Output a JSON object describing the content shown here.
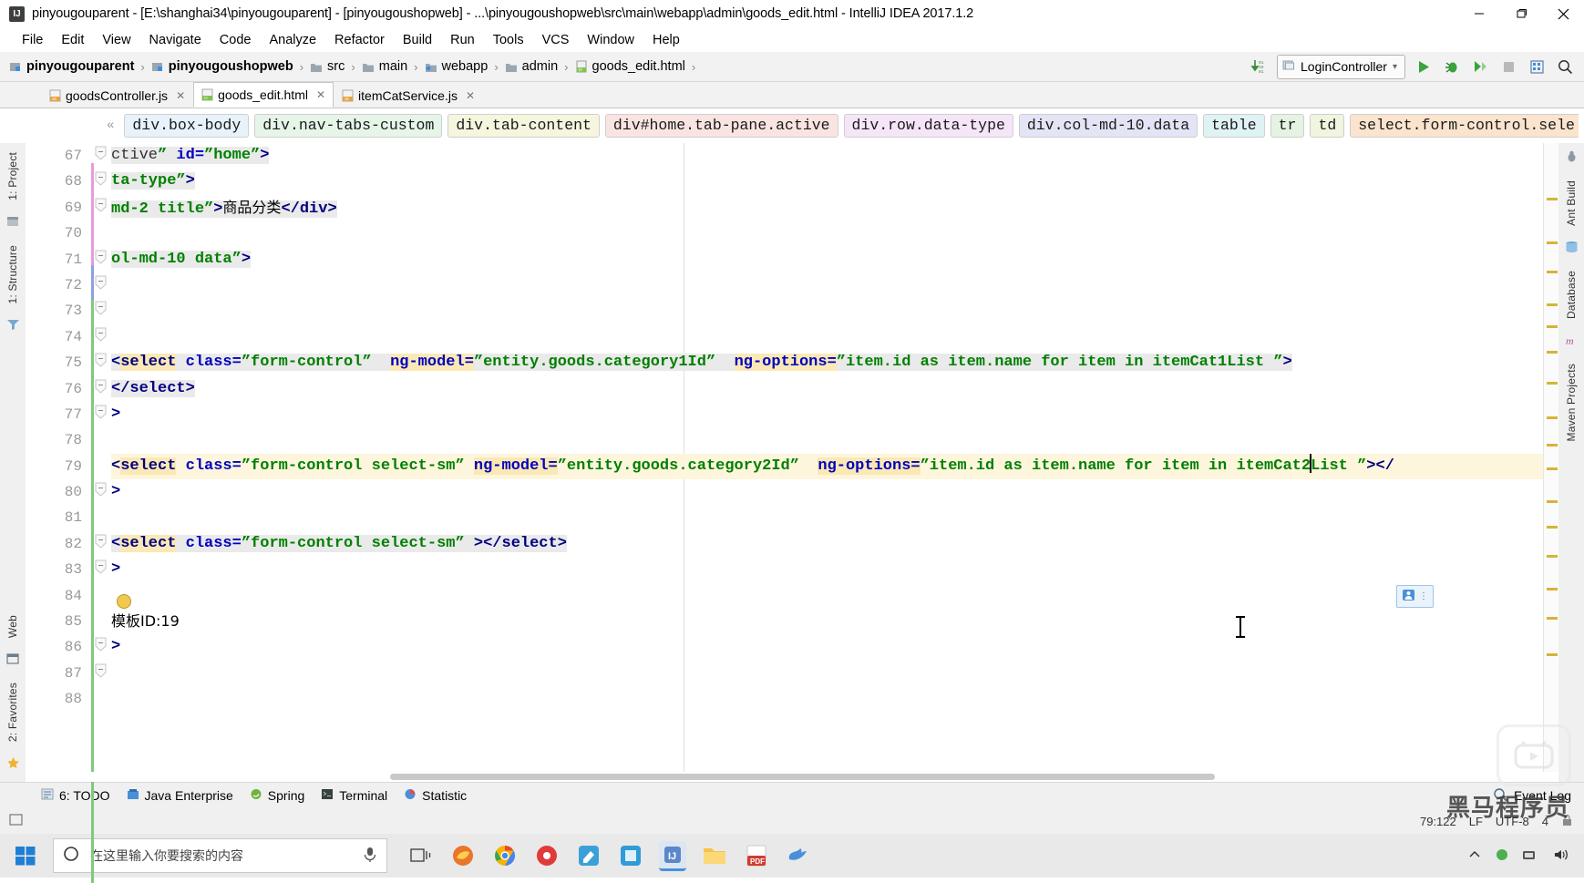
{
  "window": {
    "title": "pinyougouparent - [E:\\shanghai34\\pinyougouparent] - [pinyougoushopweb] - ...\\pinyougoushopweb\\src\\main\\webapp\\admin\\goods_edit.html - IntelliJ IDEA 2017.1.2",
    "app_icon": "intellij-idea-icon",
    "minimize": "─",
    "maximize": "❐",
    "close": "✕"
  },
  "menu": {
    "items": [
      "File",
      "Edit",
      "View",
      "Navigate",
      "Code",
      "Analyze",
      "Refactor",
      "Build",
      "Run",
      "Tools",
      "VCS",
      "Window",
      "Help"
    ]
  },
  "navbar": {
    "crumbs": [
      {
        "label": "pinyougouparent",
        "icon": "module-icon",
        "bold": true
      },
      {
        "label": "pinyougoushopweb",
        "icon": "module-icon",
        "bold": true
      },
      {
        "label": "src",
        "icon": "folder-icon",
        "bold": false
      },
      {
        "label": "main",
        "icon": "folder-icon",
        "bold": false
      },
      {
        "label": "webapp",
        "icon": "folder-web-icon",
        "bold": false
      },
      {
        "label": "admin",
        "icon": "folder-icon",
        "bold": false
      },
      {
        "label": "goods_edit.html",
        "icon": "html-file-icon",
        "bold": false
      }
    ],
    "separator": "›",
    "run_config": "LoginController",
    "run_config_dropdown": "▾",
    "buttons": [
      "update-running-application-icon",
      "run-icon",
      "debug-icon",
      "run-coverage-icon",
      "stop-icon",
      "toggle-layout-icon",
      "search-everywhere-icon"
    ]
  },
  "tabs": [
    {
      "label": "goodsController.js",
      "icon": "js-file-icon",
      "active": false,
      "close": "✕"
    },
    {
      "label": "goods_edit.html",
      "icon": "html-file-icon",
      "active": true,
      "close": "✕"
    },
    {
      "label": "itemCatService.js",
      "icon": "js-file-icon",
      "active": false,
      "close": "✕"
    }
  ],
  "breadcrumb_selectors": {
    "collapse_label": "«",
    "pills": [
      {
        "label": "div.box-body",
        "color": "#e7f2fb"
      },
      {
        "label": "div.nav-tabs-custom",
        "color": "#e5f5e8"
      },
      {
        "label": "div.tab-content",
        "color": "#f6f6df"
      },
      {
        "label": "div#home.tab-pane.active",
        "color": "#fae4e2"
      },
      {
        "label": "div.row.data-type",
        "color": "#f6e5f8"
      },
      {
        "label": "div.col-md-10.data",
        "color": "#e3e4f5"
      },
      {
        "label": "table",
        "color": "#dff2f4"
      },
      {
        "label": "tr",
        "color": "#e5f3e3"
      },
      {
        "label": "td",
        "color": "#eff5df"
      },
      {
        "label": "select.form-control.sele",
        "color": "#fae4cd"
      }
    ]
  },
  "editor": {
    "first_line": 67,
    "lines": [
      {
        "n": 67,
        "tokens": [
          {
            "t": "plain",
            "s": "ctive"
          },
          {
            "t": "val",
            "s": "” "
          },
          {
            "t": "attr",
            "s": "id="
          },
          {
            "t": "val",
            "s": "”home”"
          },
          {
            "t": "tag",
            "s": ">"
          }
        ],
        "soft": true
      },
      {
        "n": 68,
        "tokens": [
          {
            "t": "val",
            "s": "ta-type”"
          },
          {
            "t": "tag",
            "s": ">"
          }
        ],
        "soft": true
      },
      {
        "n": 69,
        "tokens": [
          {
            "t": "val",
            "s": "md-2 title”"
          },
          {
            "t": "tag",
            "s": ">"
          },
          {
            "t": "cjk",
            "s": "商品分类"
          },
          {
            "t": "tag",
            "s": "</div>"
          }
        ],
        "soft": true
      },
      {
        "n": 70,
        "tokens": [],
        "soft": false
      },
      {
        "n": 71,
        "tokens": [
          {
            "t": "val",
            "s": "ol-md-10 data”"
          },
          {
            "t": "tag",
            "s": ">"
          }
        ],
        "soft": true
      },
      {
        "n": 72,
        "tokens": [],
        "soft": false
      },
      {
        "n": 73,
        "tokens": [],
        "soft": false
      },
      {
        "n": 74,
        "tokens": [],
        "soft": false
      },
      {
        "n": 75,
        "tokens": [
          {
            "t": "tag",
            "s": "<"
          },
          {
            "t": "hltag",
            "s": "select"
          },
          {
            "t": "plain",
            "s": " "
          },
          {
            "t": "attr",
            "s": "class="
          },
          {
            "t": "val",
            "s": "”form-control”"
          },
          {
            "t": "plain",
            "s": "  "
          },
          {
            "t": "hlattr",
            "s": "ng-model="
          },
          {
            "t": "val",
            "s": "”entity.goods.category1Id”"
          },
          {
            "t": "plain",
            "s": "  "
          },
          {
            "t": "hlattr",
            "s": "ng-options="
          },
          {
            "t": "val",
            "s": "”item.id as item.name for item in itemCat1List ”"
          },
          {
            "t": "tag",
            "s": ">"
          }
        ],
        "soft": true
      },
      {
        "n": 76,
        "tokens": [
          {
            "t": "tag",
            "s": "</select>"
          }
        ],
        "soft": true
      },
      {
        "n": 77,
        "tokens": [
          {
            "t": "tag",
            "s": ">"
          }
        ],
        "soft": false
      },
      {
        "n": 78,
        "tokens": [],
        "soft": false
      },
      {
        "n": 79,
        "tokens": [
          {
            "t": "tag",
            "s": "<"
          },
          {
            "t": "hltag",
            "s": "select"
          },
          {
            "t": "plain",
            "s": " "
          },
          {
            "t": "attr",
            "s": "class="
          },
          {
            "t": "val",
            "s": "”form-control select-sm”"
          },
          {
            "t": "plain",
            "s": " "
          },
          {
            "t": "hlattr",
            "s": "ng-model="
          },
          {
            "t": "val",
            "s": "”entity.goods.category2Id”"
          },
          {
            "t": "plain",
            "s": "  "
          },
          {
            "t": "hlattr",
            "s": "ng-options="
          },
          {
            "t": "val",
            "s": "”item.id as item.name for item in itemCat2"
          },
          {
            "t": "caret",
            "s": ""
          },
          {
            "t": "val",
            "s": "List ”"
          },
          {
            "t": "tag",
            "s": "></"
          }
        ],
        "soft": false,
        "current": true
      },
      {
        "n": 80,
        "tokens": [
          {
            "t": "tag",
            "s": ">"
          }
        ],
        "soft": false
      },
      {
        "n": 81,
        "tokens": [],
        "soft": false
      },
      {
        "n": 82,
        "tokens": [
          {
            "t": "tag",
            "s": "<"
          },
          {
            "t": "hltag",
            "s": "select"
          },
          {
            "t": "plain",
            "s": " "
          },
          {
            "t": "attr",
            "s": "class="
          },
          {
            "t": "val",
            "s": "”form-control select-sm”"
          },
          {
            "t": "plain",
            "s": " "
          },
          {
            "t": "tag",
            "s": "></select>"
          }
        ],
        "soft": true
      },
      {
        "n": 83,
        "tokens": [
          {
            "t": "tag",
            "s": ">"
          }
        ],
        "soft": false
      },
      {
        "n": 84,
        "tokens": [],
        "soft": false
      },
      {
        "n": 85,
        "tokens": [
          {
            "t": "cjk",
            "s": "模板ID:19"
          }
        ],
        "soft": false
      },
      {
        "n": 86,
        "tokens": [
          {
            "t": "tag",
            "s": ">"
          }
        ],
        "soft": false
      },
      {
        "n": 87,
        "tokens": [],
        "soft": false
      },
      {
        "n": 88,
        "tokens": [],
        "soft": false
      }
    ]
  },
  "left_rail": {
    "items": [
      "1: Project",
      "1: Structure",
      "Web",
      "2: Favorites"
    ]
  },
  "right_rail": {
    "items": [
      "Ant Build",
      "Database",
      "Maven Projects"
    ]
  },
  "bottom_tools": [
    {
      "label": "6: TODO",
      "icon": "todo-icon"
    },
    {
      "label": "Java Enterprise",
      "icon": "java-enterprise-icon"
    },
    {
      "label": "Spring",
      "icon": "spring-icon"
    },
    {
      "label": "Terminal",
      "icon": "terminal-icon"
    },
    {
      "label": "Statistic",
      "icon": "statistic-icon"
    }
  ],
  "status": {
    "event_log": "Event Log",
    "caret_position": "79:122",
    "line_separator": "LF",
    "encoding": "UTF-8",
    "indent": "4",
    "lock_icon": "lock-icon"
  },
  "taskbar": {
    "start_icon": "windows-start-icon",
    "search_placeholder": "在这里输入你要搜索的内容",
    "search_icon": "search-circle-icon",
    "mic_icon": "microphone-icon",
    "taskview_icon": "task-view-icon",
    "apps": [
      {
        "name": "fox-browser-icon",
        "color": "#e8a33d"
      },
      {
        "name": "chrome-icon",
        "color": "#4285f4"
      },
      {
        "name": "red-app-icon",
        "color": "#e03a3a"
      },
      {
        "name": "editor-app-icon",
        "color": "#3ca0d8"
      },
      {
        "name": "blue-square-app-icon",
        "color": "#2f9bd8"
      },
      {
        "name": "intellij-idea-taskbar-icon",
        "color": "#5a87c9"
      },
      {
        "name": "file-explorer-icon",
        "color": "#f6c34a"
      },
      {
        "name": "pdf-reader-icon",
        "color": "#d23c2e"
      },
      {
        "name": "bird-app-icon",
        "color": "#4a90d9"
      }
    ],
    "tray": [
      "show-hidden-icons-chevron",
      "green-dot-icon",
      "network-icon",
      "volume-icon"
    ]
  },
  "overlay": {
    "watermark": "黑马程序员",
    "bili_icon": "bilibili-logo-icon",
    "float_tool": "inspection-widget-icon"
  },
  "colors": {
    "accent_green": "#4a9e4a",
    "current_line": "#fdf6dd",
    "highlight": "#fae9b4",
    "tag": "#000080",
    "attr": "#0000c0",
    "value": "#008000"
  }
}
